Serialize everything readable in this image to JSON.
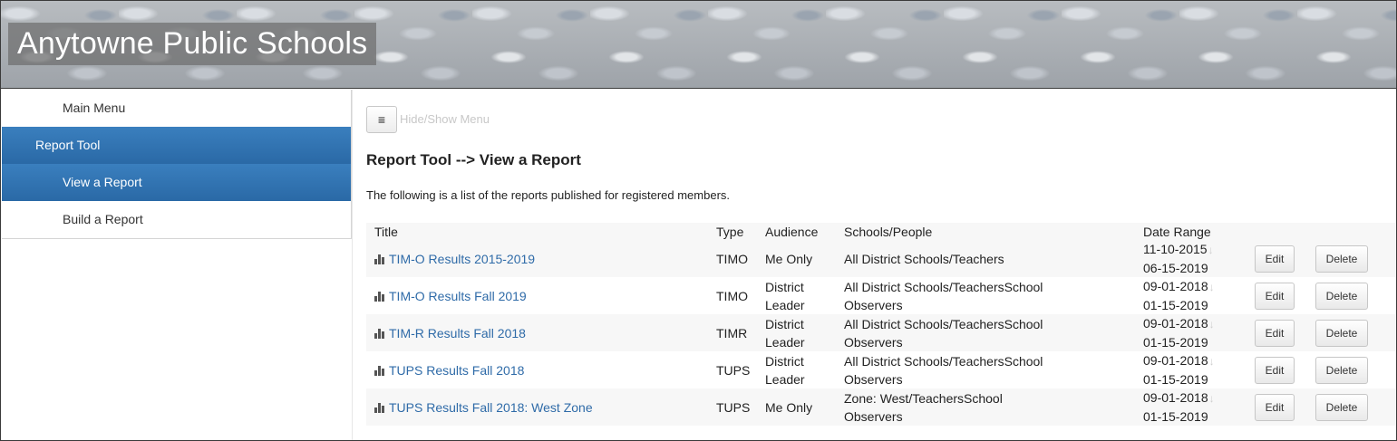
{
  "header": {
    "title": "Anytowne Public Schools"
  },
  "sidebar": {
    "items": [
      {
        "label": "Main Menu"
      },
      {
        "label": "Report Tool"
      },
      {
        "label": "View a Report"
      },
      {
        "label": "Build a Report"
      }
    ]
  },
  "main": {
    "toggle_icon": "≡",
    "toggle_label": "Hide/Show Menu",
    "page_title": "Report Tool --> View a Report",
    "intro": "The following is a list of the reports published for registered members.",
    "columns": [
      "Title",
      "Type",
      "Audience",
      "Schools/People",
      "Date Range"
    ],
    "sort_icon": "↓",
    "edit_label": "Edit",
    "delete_label": "Delete",
    "rows": [
      {
        "title": "TIM-O Results 2015-2019",
        "type": "TIMO",
        "audience_1": "Me Only",
        "audience_2": "",
        "schools_1": "All District Schools/Teachers",
        "schools_2": "",
        "date_start": "11-10-2015",
        "date_end": "06-15-2019"
      },
      {
        "title": "TIM-O Results Fall 2019",
        "type": "TIMO",
        "audience_1": "District",
        "audience_2": "Leader",
        "schools_1": "All District Schools/TeachersSchool",
        "schools_2": "Observers",
        "date_start": "09-01-2018",
        "date_end": "01-15-2019"
      },
      {
        "title": "TIM-R Results Fall 2018",
        "type": "TIMR",
        "audience_1": "District",
        "audience_2": "Leader",
        "schools_1": "All District Schools/TeachersSchool",
        "schools_2": "Observers",
        "date_start": "09-01-2018",
        "date_end": "01-15-2019"
      },
      {
        "title": "TUPS Results Fall 2018",
        "type": "TUPS",
        "audience_1": "District",
        "audience_2": "Leader",
        "schools_1": "All District Schools/TeachersSchool",
        "schools_2": "Observers",
        "date_start": "09-01-2018",
        "date_end": "01-15-2019"
      },
      {
        "title": "TUPS Results Fall 2018: West Zone",
        "type": "TUPS",
        "audience_1": "Me Only",
        "audience_2": "",
        "schools_1": "Zone: West/TeachersSchool",
        "schools_2": "Observers",
        "date_start": "09-01-2018",
        "date_end": "01-15-2019"
      }
    ]
  },
  "colors": {
    "accent": "#2a69a6",
    "link": "#2f6ba8",
    "row_alt": "#f7f7f7"
  },
  "icons": {
    "report": "bar-chart-icon",
    "menu": "hamburger-icon",
    "sort": "sort-down-icon"
  }
}
